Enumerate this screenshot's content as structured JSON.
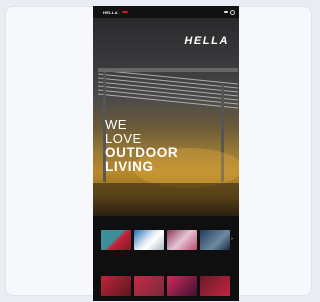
{
  "navbar": {
    "logo": "HELLA",
    "highlight": "",
    "items": [
      "",
      "",
      "",
      "",
      "",
      "",
      ""
    ],
    "pill": ""
  },
  "hero": {
    "logo": "HELLA",
    "line1": "WE",
    "line2": "LOVE",
    "line3": "OUTDOOR",
    "line4": "LIVING"
  },
  "section1": {
    "title": "",
    "thumbs": [
      {
        "caption": "",
        "color_a": "#3b8f9a",
        "color_b": "#c2243b"
      },
      {
        "caption": "",
        "color_a": "#1f6fb8",
        "color_b": "#ffffff"
      },
      {
        "caption": "",
        "color_a": "#8a3a5c",
        "color_b": "#e5c6d5"
      },
      {
        "caption": "",
        "color_a": "#243b5c",
        "color_b": "#6e8aa3"
      }
    ]
  },
  "section2": {
    "title": "",
    "thumbs": [
      {
        "color_a": "#c0253a",
        "color_b": "#5a1820"
      },
      {
        "color_a": "#c32a43",
        "color_b": "#7a2a3c"
      },
      {
        "color_a": "#d12a5c",
        "color_b": "#3d1130"
      },
      {
        "color_a": "#6a1a28",
        "color_b": "#c02540"
      }
    ]
  },
  "colors": {
    "brand_red": "#d3172a",
    "gold": "#b8892d"
  }
}
